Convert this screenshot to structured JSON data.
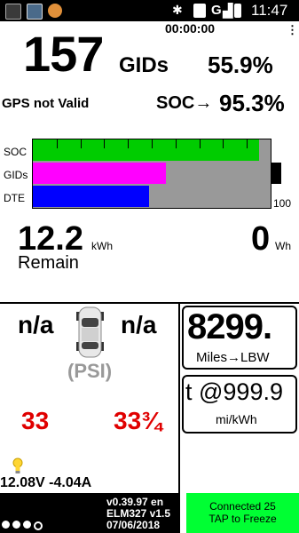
{
  "status_bar": {
    "time": "11:47",
    "icons": [
      "camera-icon",
      "photo-icon",
      "notification-off-icon",
      "bluetooth-icon",
      "network-icon",
      "wifi-icon",
      "signal-icon",
      "battery-icon"
    ],
    "signal_label": "G"
  },
  "header": {
    "timer": "00:00:00",
    "menu_glyph": "⋮",
    "gids_value": "157",
    "gids_label": "GIDs",
    "gids_percent": "55.9%",
    "gps_status": "GPS not Valid",
    "soc_label": "SOC→",
    "soc_value": "95.3%"
  },
  "bars": {
    "labels": [
      "SOC",
      "GIDs",
      "DTE"
    ],
    "max_label": "100",
    "colors": {
      "soc": "#00cc00",
      "gids": "#ff00ff",
      "dte": "#0000ff",
      "background": "#999999"
    },
    "values": {
      "soc": 0.953,
      "gids": 0.559,
      "dte": 0.49
    }
  },
  "energy": {
    "remain_value": "12.2",
    "remain_unit": "kWh",
    "remain_label": "Remain",
    "wh_value": "0",
    "wh_unit": "Wh"
  },
  "tires": {
    "front_left": "n/a",
    "front_right": "n/a",
    "unit_label": "(PSI)",
    "rear_left": "33",
    "rear_right": "33¾",
    "alert_color": "#e00000"
  },
  "battery": {
    "voltage_current": "12.08V -4.04A"
  },
  "range": {
    "miles_value": "8299.",
    "miles_label": "Miles→LBW",
    "efficiency_value": "t @999.9",
    "efficiency_label": "mi/kWh"
  },
  "footer": {
    "version_line1": "v0.39.97 en",
    "version_line2": "ELM327 v1.5",
    "version_line3": "07/06/2018",
    "connected_line1": "Connected 25",
    "connected_line2": "TAP to Freeze",
    "connected_color": "#00ff33"
  }
}
